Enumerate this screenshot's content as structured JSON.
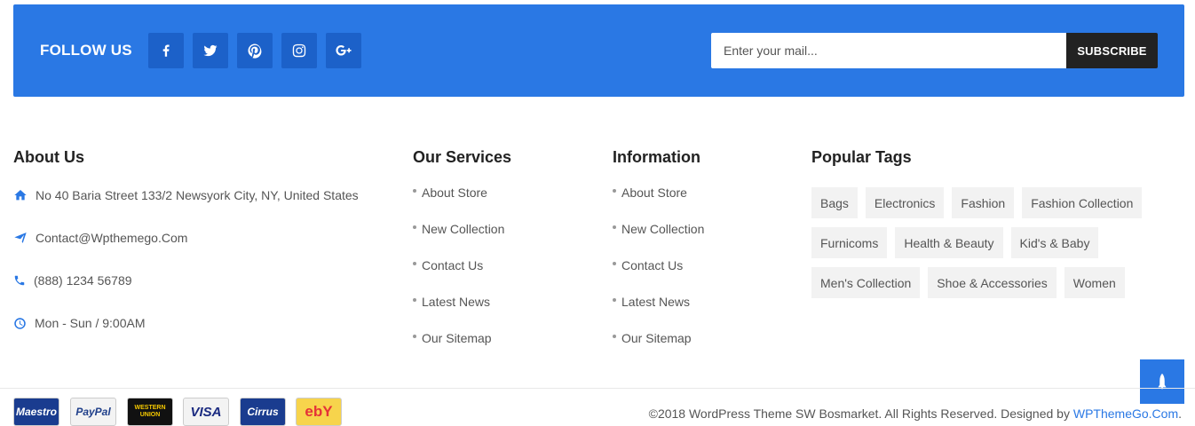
{
  "follow": {
    "title": "FOLLOW US",
    "socials": [
      "facebook-icon",
      "twitter-icon",
      "pinterest-icon",
      "instagram-icon",
      "google-plus-icon"
    ],
    "email_placeholder": "Enter your mail...",
    "subscribe_label": "SUBSCRIBE"
  },
  "about": {
    "title": "About Us",
    "address": "No 40 Baria Street 133/2 Newsyork City, NY, United States",
    "email": "Contact@Wpthemego.Com",
    "phone": "(888) 1234 56789",
    "hours": "Mon - Sun / 9:00AM"
  },
  "services": {
    "title": "Our Services",
    "links": [
      "About Store",
      "New Collection",
      "Contact Us",
      "Latest News",
      "Our Sitemap"
    ]
  },
  "information": {
    "title": "Information",
    "links": [
      "About Store",
      "New Collection",
      "Contact Us",
      "Latest News",
      "Our Sitemap"
    ]
  },
  "tags": {
    "title": "Popular Tags",
    "items": [
      "Bags",
      "Electronics",
      "Fashion",
      "Fashion Collection",
      "Furnicoms",
      "Health & Beauty",
      "Kid's & Baby",
      "Men's Collection",
      "Shoe & Accessories",
      "Women"
    ]
  },
  "payments": [
    {
      "name": "Maestro",
      "bg": "#1a3c8f",
      "fg": "#ffffff"
    },
    {
      "name": "PayPal",
      "bg": "#f3f3f3",
      "fg": "#1f3f8a"
    },
    {
      "name": "WESTERN UNION",
      "bg": "#111111",
      "fg": "#f6c900"
    },
    {
      "name": "VISA",
      "bg": "#f3f3f3",
      "fg": "#1a2a80"
    },
    {
      "name": "Cirrus",
      "bg": "#1a3c8f",
      "fg": "#ffffff"
    },
    {
      "name": "ebY",
      "bg": "#f7d44c",
      "fg": "#e53238"
    }
  ],
  "footer": {
    "copyright": "©2018 WordPress Theme SW Bosmarket. All Rights Reserved. Designed by ",
    "designer": "WPThemeGo.Com",
    "suffix": "."
  },
  "colors": {
    "accent": "#2a78e4",
    "social_bg": "#1c61c9",
    "dark": "#222222",
    "tag_bg": "#f2f2f2"
  }
}
